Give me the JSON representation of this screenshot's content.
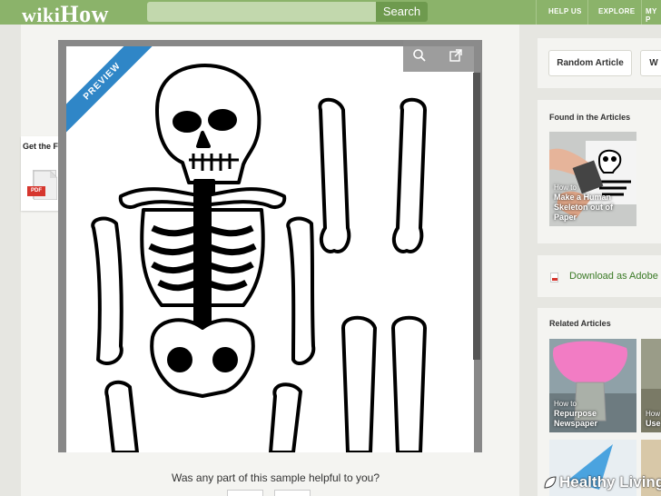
{
  "header": {
    "logo_wiki": "wiki",
    "logo_how": "How",
    "search_placeholder": "",
    "search_button": "Search",
    "nav": [
      "HELP US",
      "EXPLORE",
      "MY P"
    ]
  },
  "sidebar_left": {
    "get_file_label": "Get the File",
    "pdf_tag": "PDF"
  },
  "preview": {
    "ribbon": "PREVIEW",
    "zoom_icon": "magnifier-icon",
    "open_icon": "external-link-icon"
  },
  "feedback": {
    "question": "Was any part of this sample helpful to you?"
  },
  "right": {
    "buttons": [
      "Random Article",
      "W"
    ],
    "found_title": "Found in the Articles",
    "found_article": {
      "how_to": "How to",
      "title_lines": [
        "Make a Human",
        "Skeleton out of",
        "Paper"
      ]
    },
    "download_label": "Download as Adobe P",
    "related_title": "Related Articles",
    "related": [
      {
        "how_to": "How to",
        "title_lines": [
          "Repurpose",
          "Newspaper"
        ]
      },
      {
        "how_to": "How",
        "title_lines": [
          "Use"
        ]
      }
    ]
  },
  "watermark": "Healthy Living",
  "colors": {
    "header_green": "#8bb36a",
    "search_button": "#6e9a4e",
    "ribbon_blue": "#2f86c7",
    "pdf_red": "#d6362e",
    "link_green": "#3a7a26"
  }
}
